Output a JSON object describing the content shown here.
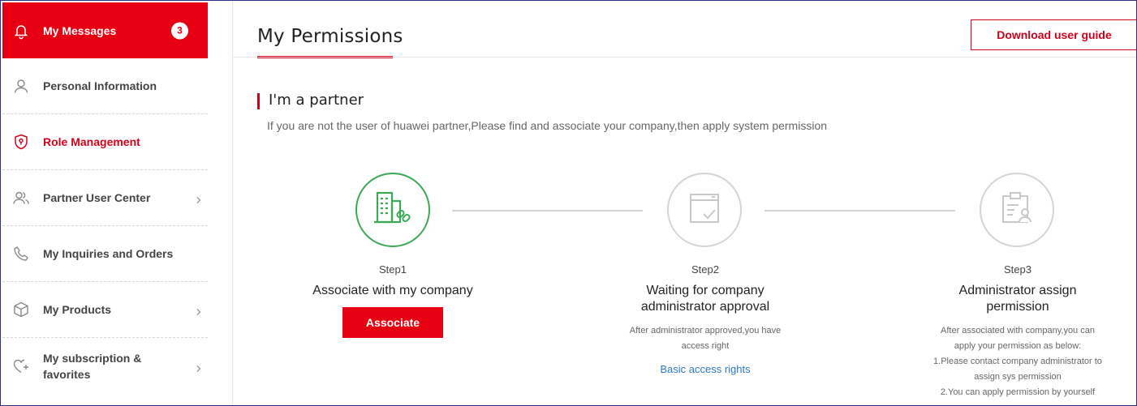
{
  "sidebar": {
    "items": [
      {
        "label": "My Messages",
        "badge": "3",
        "icon": "bell-icon"
      },
      {
        "label": "Personal Information",
        "icon": "person-icon"
      },
      {
        "label": "Role Management",
        "icon": "shield-icon"
      },
      {
        "label": "Partner User Center",
        "icon": "users-icon"
      },
      {
        "label": "My Inquiries and Orders",
        "icon": "phone-icon"
      },
      {
        "label": "My Products",
        "icon": "box-icon"
      },
      {
        "label": "My subscription & favorites",
        "icon": "heart-plus-icon"
      }
    ]
  },
  "header": {
    "title": "My Permissions",
    "guide_button": "Download user guide"
  },
  "section": {
    "title": "I'm a partner",
    "description": "If you are not the user of huawei partner,Please find and associate your company,then apply system permission"
  },
  "steps": [
    {
      "label": "Step1",
      "title": "Associate with my company",
      "button": "Associate",
      "icon": "building-link-icon"
    },
    {
      "label": "Step2",
      "title_line1": "Waiting for company",
      "title_line2": "administrator approval",
      "note_line1": "After administrator approved,you have",
      "note_line2": "access right",
      "link": "Basic access rights",
      "icon": "window-check-icon"
    },
    {
      "label": "Step3",
      "title_line1": "Administrator assign",
      "title_line2": "permission",
      "note_lines": [
        "After associated with company,you can",
        "apply your permission as below:",
        "1.Please contact company administrator to",
        "assign sys permission",
        "2.You can apply permission by yourself"
      ],
      "icon": "clipboard-user-icon"
    }
  ],
  "colors": {
    "accent": "#e60012",
    "success": "#3aa955",
    "link": "#2a7ac0"
  }
}
